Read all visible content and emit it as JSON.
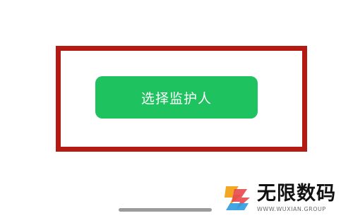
{
  "main": {
    "primary_button_label": "选择监护人"
  },
  "watermark": {
    "title": "无限数码",
    "subtitle": "WWW.WUXIAN.GROUP"
  },
  "colors": {
    "highlight_border": "#b41a12",
    "button_background": "#1ec25f",
    "button_text": "#ffffff",
    "home_indicator": "#9b9b9b"
  },
  "icons": {
    "watermark_logo": "wuxian-logo-icon"
  }
}
